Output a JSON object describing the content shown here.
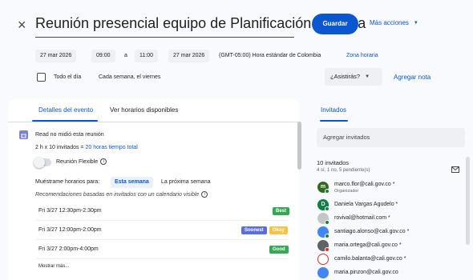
{
  "header": {
    "close_glyph": "×",
    "title": "Reunión presencial equipo de Planificación turística",
    "save_label": "Guardar",
    "more_actions_label": "Más acciones",
    "caret_glyph": "▼"
  },
  "datetime": {
    "start_date": "27 mar 2026",
    "start_time": "09:00",
    "separator": "a",
    "end_time": "11:00",
    "end_date": "27 mar 2026",
    "timezone": "(GMT-05:00) Hora estándar de Colombia",
    "timezone_link": "Zona horaria"
  },
  "options": {
    "all_day_label": "Todo el día",
    "recurrence": "Cada semana, el viernes",
    "rsvp_label": "¿Asistirás?",
    "add_note_label": "Agregar nota"
  },
  "tabs": {
    "details": "Detalles del evento",
    "availability": "Ver horarios disponibles"
  },
  "details": {
    "read_status": "Read no midió esta reunión",
    "time_summary_prefix": "2 h x 10 invitados = ",
    "time_summary_total": "20 horas tiempo total",
    "flexible_label": "Reunión Flexible",
    "info_glyph": "i",
    "show_times_label": "Muéstrame horarios para:",
    "this_week": "Esta semana",
    "next_week": "La próxima semana",
    "recommendations_note": "Recomendaciones basadas en invitados con un calendario visible",
    "slots": [
      {
        "label": "Fri 3/27 12:30pm-2:30pm",
        "badges": [
          "Best"
        ]
      },
      {
        "label": "Fri 3/27 12:00pm-2:00pm",
        "badges": [
          "Soonest",
          "Okay"
        ]
      },
      {
        "label": "Fri 3/27 2:00pm-4:00pm",
        "badges": [
          "Good"
        ]
      }
    ],
    "show_more": "Mostrar más..."
  },
  "guests": {
    "tab_label": "Invitados",
    "add_placeholder": "Agregar invitados",
    "count_label": "10 invitados",
    "count_detail": "4 sí, 1 no, 5 pendiente(s)",
    "list": [
      {
        "email": "marco.flor@cali.gov.co *",
        "role": "Organizador",
        "avatar_letter": "m",
        "avatar_color": "#33691e",
        "status": "yes"
      },
      {
        "email": "Daniela Vargas Agudelo *",
        "role": "",
        "avatar_letter": "D",
        "avatar_color": "#0b8043",
        "status": "yes"
      },
      {
        "email": "rovival@hotmail.com *",
        "role": "",
        "avatar_letter": "",
        "avatar_color": "#c4c7c5",
        "status": "yes"
      },
      {
        "email": "santiago.alonso@cali.gov.co *",
        "role": "",
        "avatar_letter": "",
        "avatar_color": "#4285f4",
        "status": "yes"
      },
      {
        "email": "maria.ortega@cali.gov.co *",
        "role": "",
        "avatar_letter": "",
        "avatar_color": "#5f6368",
        "status": "no"
      },
      {
        "email": "camilo.balanta@cali.gov.co *",
        "role": "",
        "avatar_letter": "",
        "avatar_color": "#d93025",
        "status": "none"
      },
      {
        "email": "maria.pinzon@cali.gov.co",
        "role": "",
        "avatar_letter": "",
        "avatar_color": "#4285f4",
        "status": "none"
      }
    ]
  }
}
